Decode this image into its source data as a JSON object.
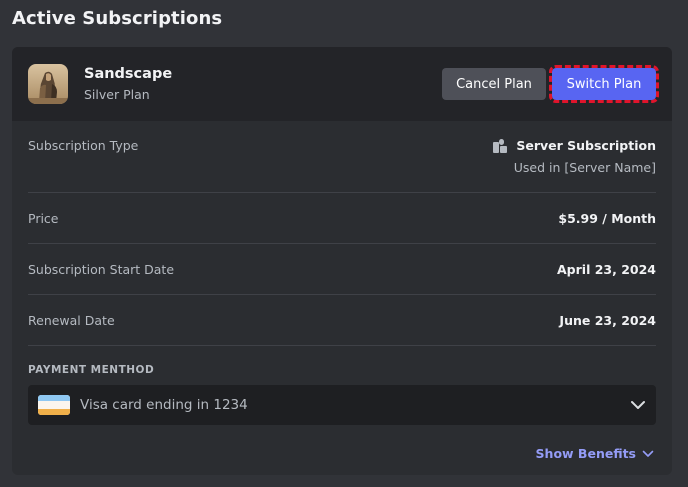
{
  "page_title": "Active Subscriptions",
  "subscription": {
    "name": "Sandscape",
    "tier": "Silver Plan",
    "avatar_icon": "game-art-avatar"
  },
  "actions": {
    "cancel_label": "Cancel Plan",
    "switch_label": "Switch Plan"
  },
  "details": {
    "type_label": "Subscription Type",
    "type_value": "Server Subscription",
    "type_icon": "server-icon",
    "type_sub": "Used in [Server Name]",
    "price_label": "Price",
    "price_value": "$5.99 / Month",
    "start_label": "Subscription Start Date",
    "start_value": "April 23, 2024",
    "renewal_label": "Renewal Date",
    "renewal_value": "June 23, 2024"
  },
  "payment": {
    "section_label": "PAYMENT MENTHOD",
    "selected": "Visa card ending in 1234",
    "card_icon": "credit-card-icon"
  },
  "footer": {
    "benefits_label": "Show Benefits"
  },
  "colors": {
    "background": "#313338",
    "card": "#2b2d31",
    "header": "#232428",
    "accent": "#5865f2",
    "link": "#949cf7",
    "highlight": "#e0142c"
  }
}
